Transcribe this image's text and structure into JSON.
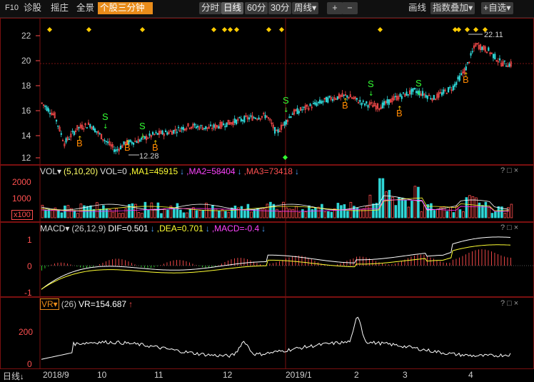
{
  "toolbar": {
    "items": [
      "F10",
      "诊股",
      "摇庄",
      "全景",
      "个股三分钟"
    ],
    "periods": [
      "分时",
      "日线",
      "60分",
      "30分",
      "周线▾"
    ],
    "selected_period": "日线",
    "plus": "+",
    "minus": "−",
    "draw": "画线",
    "index_overlay": "指数叠加▾",
    "watchlist": "+自选▾"
  },
  "colors": {
    "up": "#ff4d4d",
    "down": "#2fd6d6",
    "frame": "#7a1010",
    "ma1": "#ffffff",
    "ma2": "#ffff33",
    "ma3": "#ff33ff",
    "signal_b": "#ff8800",
    "signal_s": "#33ff33",
    "marker": "#ffcc00"
  },
  "price_panel": {
    "yticks": [
      "22",
      "20",
      "18",
      "16",
      "14",
      "12"
    ],
    "high_label": "22.11",
    "low_label": "12.28",
    "signals": [
      {
        "type": "B",
        "label": "B"
      },
      {
        "type": "S",
        "label": "S"
      },
      {
        "type": "B",
        "label": "B"
      },
      {
        "type": "S",
        "label": "S"
      },
      {
        "type": "B",
        "label": "B"
      },
      {
        "type": "S",
        "label": "S"
      },
      {
        "type": "B",
        "label": "B"
      },
      {
        "type": "S",
        "label": "S"
      },
      {
        "type": "B",
        "label": "B"
      },
      {
        "type": "S",
        "label": "S"
      },
      {
        "type": "B",
        "label": "B"
      },
      {
        "type": "S",
        "label": "S"
      },
      {
        "type": "B",
        "label": "B"
      }
    ]
  },
  "vol_panel": {
    "name": "VOL▾",
    "params": "(5,10,20)",
    "vol": "VOL=0",
    "ma1": ",MA1=45915",
    "ma2": ",MA2=58404",
    "ma3": ",MA3=73418",
    "yticks": [
      "2000",
      "1000"
    ],
    "unit": "x100"
  },
  "macd_panel": {
    "name": "MACD▾",
    "params": "(26,12,9)",
    "dif": "DIF=0.501",
    "dea": ",DEA=0.701",
    "macd": ",MACD=-0.4",
    "yticks": [
      "1",
      "0",
      "-1"
    ]
  },
  "vr_panel": {
    "name": "VR▾",
    "params": "(26)",
    "vr": "VR=154.687",
    "yticks": [
      "200",
      "0"
    ]
  },
  "x_axis": {
    "period_label": "日线",
    "labels": [
      "2018/9",
      "10",
      "11",
      "12",
      "2019/1",
      "2",
      "3",
      "4"
    ]
  },
  "panel_controls": "?□×",
  "arrow_down": "↓",
  "arrow_up": "↑"
}
